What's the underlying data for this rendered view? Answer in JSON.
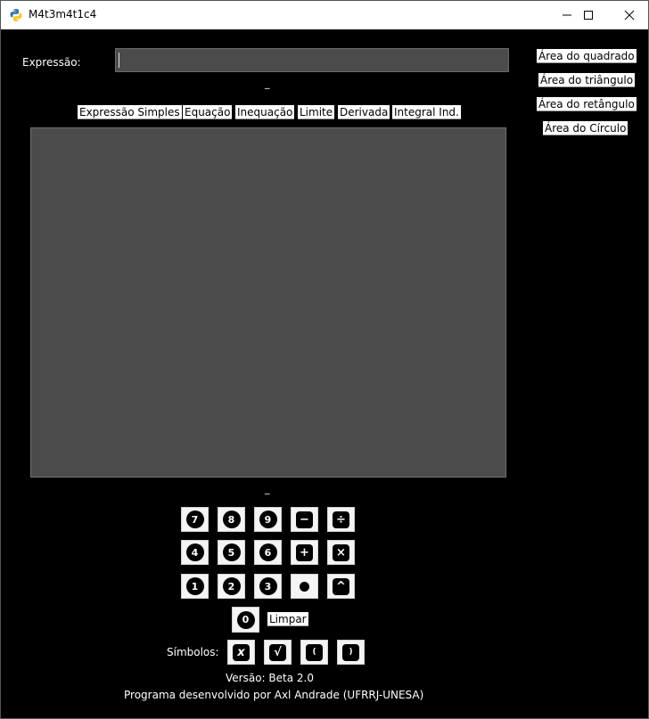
{
  "window": {
    "title": "M4t3m4t1c4",
    "minimize_glyph": "–",
    "maximize_glyph": "☐",
    "close_glyph": "✕"
  },
  "expression": {
    "label": "Expressão:",
    "value": ""
  },
  "dash_top": "_",
  "dash_bottom": "_",
  "modes": [
    "Expressão Simples",
    "Equação",
    "Inequação",
    "Limite",
    "Derivada",
    "Integral Ind."
  ],
  "area_buttons": [
    "Área do quadrado",
    "Área do triângulo",
    "Área do retângulo",
    "Área do Círculo"
  ],
  "keypad": {
    "row1": [
      "7",
      "8",
      "9",
      "−",
      "÷"
    ],
    "row2": [
      "4",
      "5",
      "6",
      "+",
      "×"
    ],
    "row3": [
      "1",
      "2",
      "3",
      "•",
      "^"
    ],
    "zero": "0",
    "clear_label": "Limpar"
  },
  "symbols": {
    "label": "Símbolos:",
    "keys": [
      "x",
      "√",
      "(",
      ")"
    ]
  },
  "footer": {
    "version": "Versão: Beta 2.0",
    "credit": "Programa desenvolvido por Axl Andrade (UFRRJ-UNESA)"
  },
  "colors": {
    "background": "#000000",
    "panel": "#4b4b4b",
    "button": "#ffffff"
  },
  "icons": {
    "app": "python-icon",
    "minimize": "minimize-icon",
    "maximize": "maximize-icon",
    "close": "close-icon"
  }
}
